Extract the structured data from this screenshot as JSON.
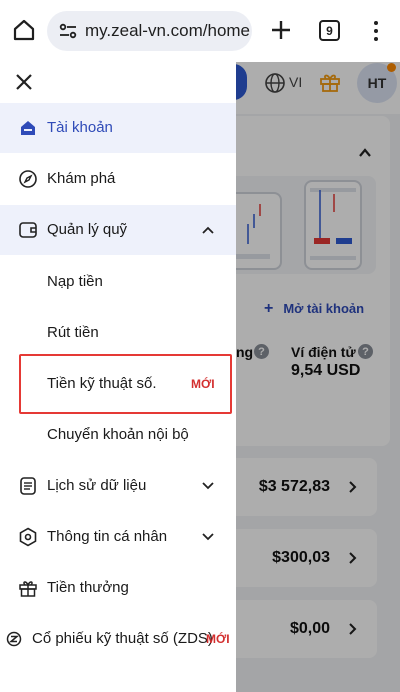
{
  "browser": {
    "url": "my.zeal-vn.com/home",
    "tab_count": "9"
  },
  "page": {
    "lang": "VI",
    "avatar_initials": "HT",
    "open_account": "Mở tài khoản",
    "label_partial": "ng",
    "wallet_label": "Ví điện tử",
    "wallet_value": "9,54 USD",
    "rows": [
      {
        "amount": "$3 572,83"
      },
      {
        "amount": "$300,03"
      },
      {
        "amount": "$0,00"
      }
    ]
  },
  "drawer": {
    "items": [
      {
        "label": "Tài khoản"
      },
      {
        "label": "Khám phá"
      },
      {
        "label": "Quản lý quỹ"
      },
      {
        "label": "Nạp tiền"
      },
      {
        "label": "Rút tiền"
      },
      {
        "label": "Tiền kỹ thuật số.",
        "badge": "MỚI"
      },
      {
        "label": "Chuyển khoản nội bộ"
      },
      {
        "label": "Lịch sử dữ liệu"
      },
      {
        "label": "Thông tin cá nhân"
      },
      {
        "label": "Tiền thưởng"
      },
      {
        "label": "Cổ phiếu kỹ thuật số (ZDS)",
        "badge": "MỚI"
      }
    ]
  },
  "colors": {
    "accent": "#2f4bb8",
    "badge": "#d32f2f",
    "highlight": "#e53935"
  }
}
